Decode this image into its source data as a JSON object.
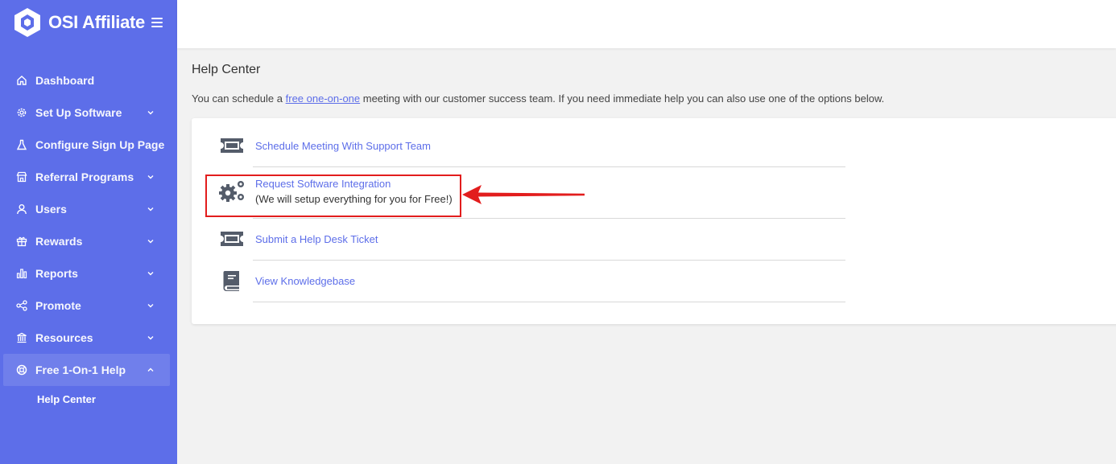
{
  "brand": {
    "name": "OSI Affiliate"
  },
  "sidebar": {
    "items": [
      {
        "label": "Dashboard",
        "icon": "home-icon",
        "has_children": false
      },
      {
        "label": "Set Up Software",
        "icon": "gear-icon",
        "has_children": true
      },
      {
        "label": "Configure Sign Up Page",
        "icon": "flask-icon",
        "has_children": false
      },
      {
        "label": "Referral Programs",
        "icon": "store-icon",
        "has_children": true
      },
      {
        "label": "Users",
        "icon": "user-icon",
        "has_children": true
      },
      {
        "label": "Rewards",
        "icon": "gift-icon",
        "has_children": true
      },
      {
        "label": "Reports",
        "icon": "bar-chart-icon",
        "has_children": true
      },
      {
        "label": "Promote",
        "icon": "share-icon",
        "has_children": true
      },
      {
        "label": "Resources",
        "icon": "bank-icon",
        "has_children": true
      },
      {
        "label": "Free 1-On-1 Help",
        "icon": "lifebuoy-icon",
        "has_children": true,
        "active": true
      }
    ],
    "sub_items": [
      {
        "label": "Help Center"
      }
    ]
  },
  "page": {
    "title": "Help Center",
    "intro_before": "You can schedule a ",
    "intro_link": "free one-on-one",
    "intro_after": " meeting with our customer success team. If you need immediate help you can also use one of the options below."
  },
  "options": [
    {
      "label": "Schedule Meeting With Support Team",
      "icon": "ticket-icon"
    },
    {
      "label": "Request Software Integration",
      "sub": "(We will setup everything for you for Free!)",
      "icon": "gears-icon"
    },
    {
      "label": "Submit a Help Desk Ticket",
      "icon": "ticket-icon"
    },
    {
      "label": "View Knowledgebase",
      "icon": "book-icon"
    }
  ],
  "colors": {
    "sidebar": "#5d6ee9",
    "link": "#5d6ee9",
    "highlight": "#e21d1d",
    "icon": "#545c6a"
  }
}
